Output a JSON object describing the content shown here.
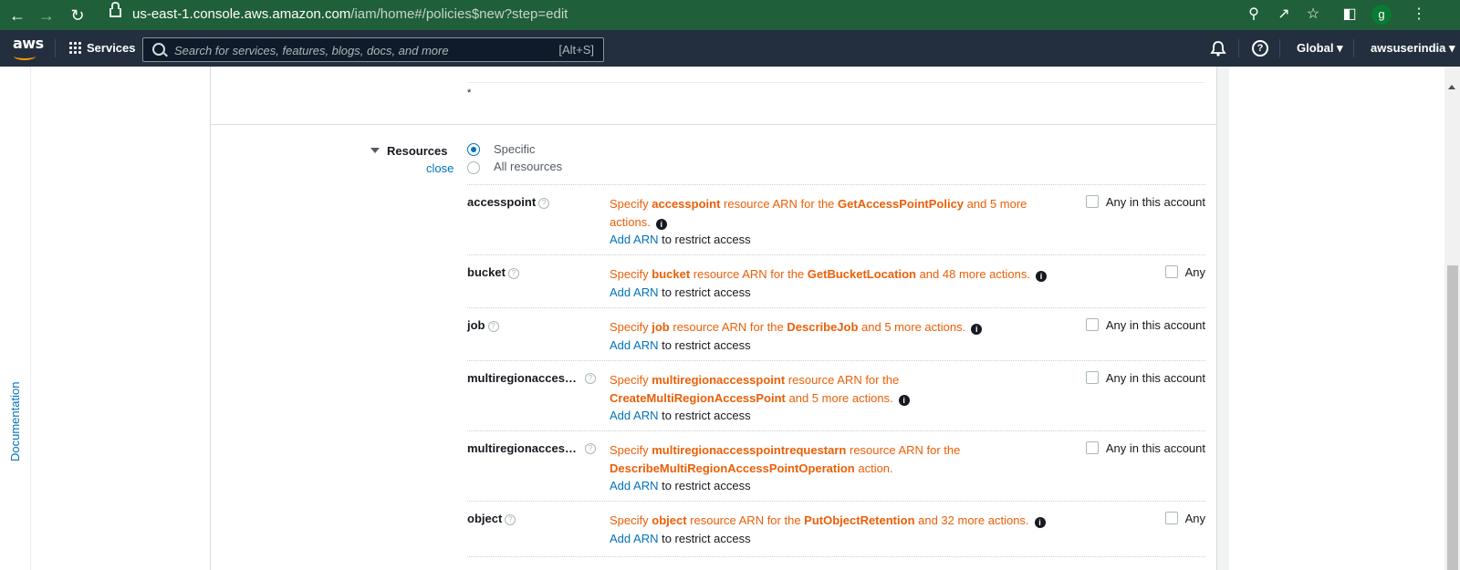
{
  "browser": {
    "url_host": "us-east-1.console.aws.amazon.com",
    "url_path": "/iam/home#/policies$new?step=edit",
    "profile_initial": "g"
  },
  "awsnav": {
    "logo": "aws",
    "services": "Services",
    "search_placeholder": "Search for services, features, blogs, docs, and more",
    "search_shortcut": "[Alt+S]",
    "region": "Global ▾",
    "account": "awsuserindia ▾"
  },
  "sidebar": {
    "documentation": "Documentation"
  },
  "editor": {
    "top_value": "*",
    "resources_title": "Resources",
    "close_label": "close",
    "radio_specific": "Specific",
    "radio_all": "All resources",
    "rows": [
      {
        "name": "accesspoint",
        "pre": "Specify ",
        "bold1": "accesspoint",
        "mid": " resource ARN for the ",
        "bold2": "GetAccessPointPolicy",
        "post": " and 5 more actions.",
        "add": "Add ARN",
        "restrict": " to restrict access",
        "any": "Any in this account"
      },
      {
        "name": "bucket",
        "pre": "Specify ",
        "bold1": "bucket",
        "mid": " resource ARN for the ",
        "bold2": "GetBucketLocation",
        "post": " and 48 more actions.",
        "add": "Add ARN",
        "restrict": " to restrict access",
        "any": "Any"
      },
      {
        "name": "job",
        "pre": "Specify ",
        "bold1": "job",
        "mid": " resource ARN for the ",
        "bold2": "DescribeJob",
        "post": " and 5 more actions.",
        "add": "Add ARN",
        "restrict": " to restrict access",
        "any": "Any in this account"
      },
      {
        "name": "multiregionacces…",
        "pre": "Specify ",
        "bold1": "multiregionaccesspoint",
        "mid": " resource ARN for the ",
        "bold2": "CreateMultiRegionAccessPoint",
        "post": " and 5 more actions.",
        "add": "Add ARN",
        "restrict": " to restrict access",
        "any": "Any in this account"
      },
      {
        "name": "multiregionacces…",
        "pre": "Specify ",
        "bold1": "multiregionaccesspointrequestarn",
        "mid": " resource ARN for the ",
        "bold2": "DescribeMultiRegionAccessPointOperation",
        "post": " action.",
        "add": "Add ARN",
        "restrict": " to restrict access",
        "any": "Any in this account"
      },
      {
        "name": "object",
        "pre": "Specify ",
        "bold1": "object",
        "mid": " resource ARN for the ",
        "bold2": "PutObjectRetention",
        "post": " and 32 more actions.",
        "add": "Add ARN",
        "restrict": " to restrict access",
        "any": "Any"
      }
    ]
  },
  "colors": {
    "aws_nav": "#232f3e",
    "chrome": "#1f5f3a",
    "warning_orange": "#eb5f07",
    "link_blue": "#0073bb"
  }
}
